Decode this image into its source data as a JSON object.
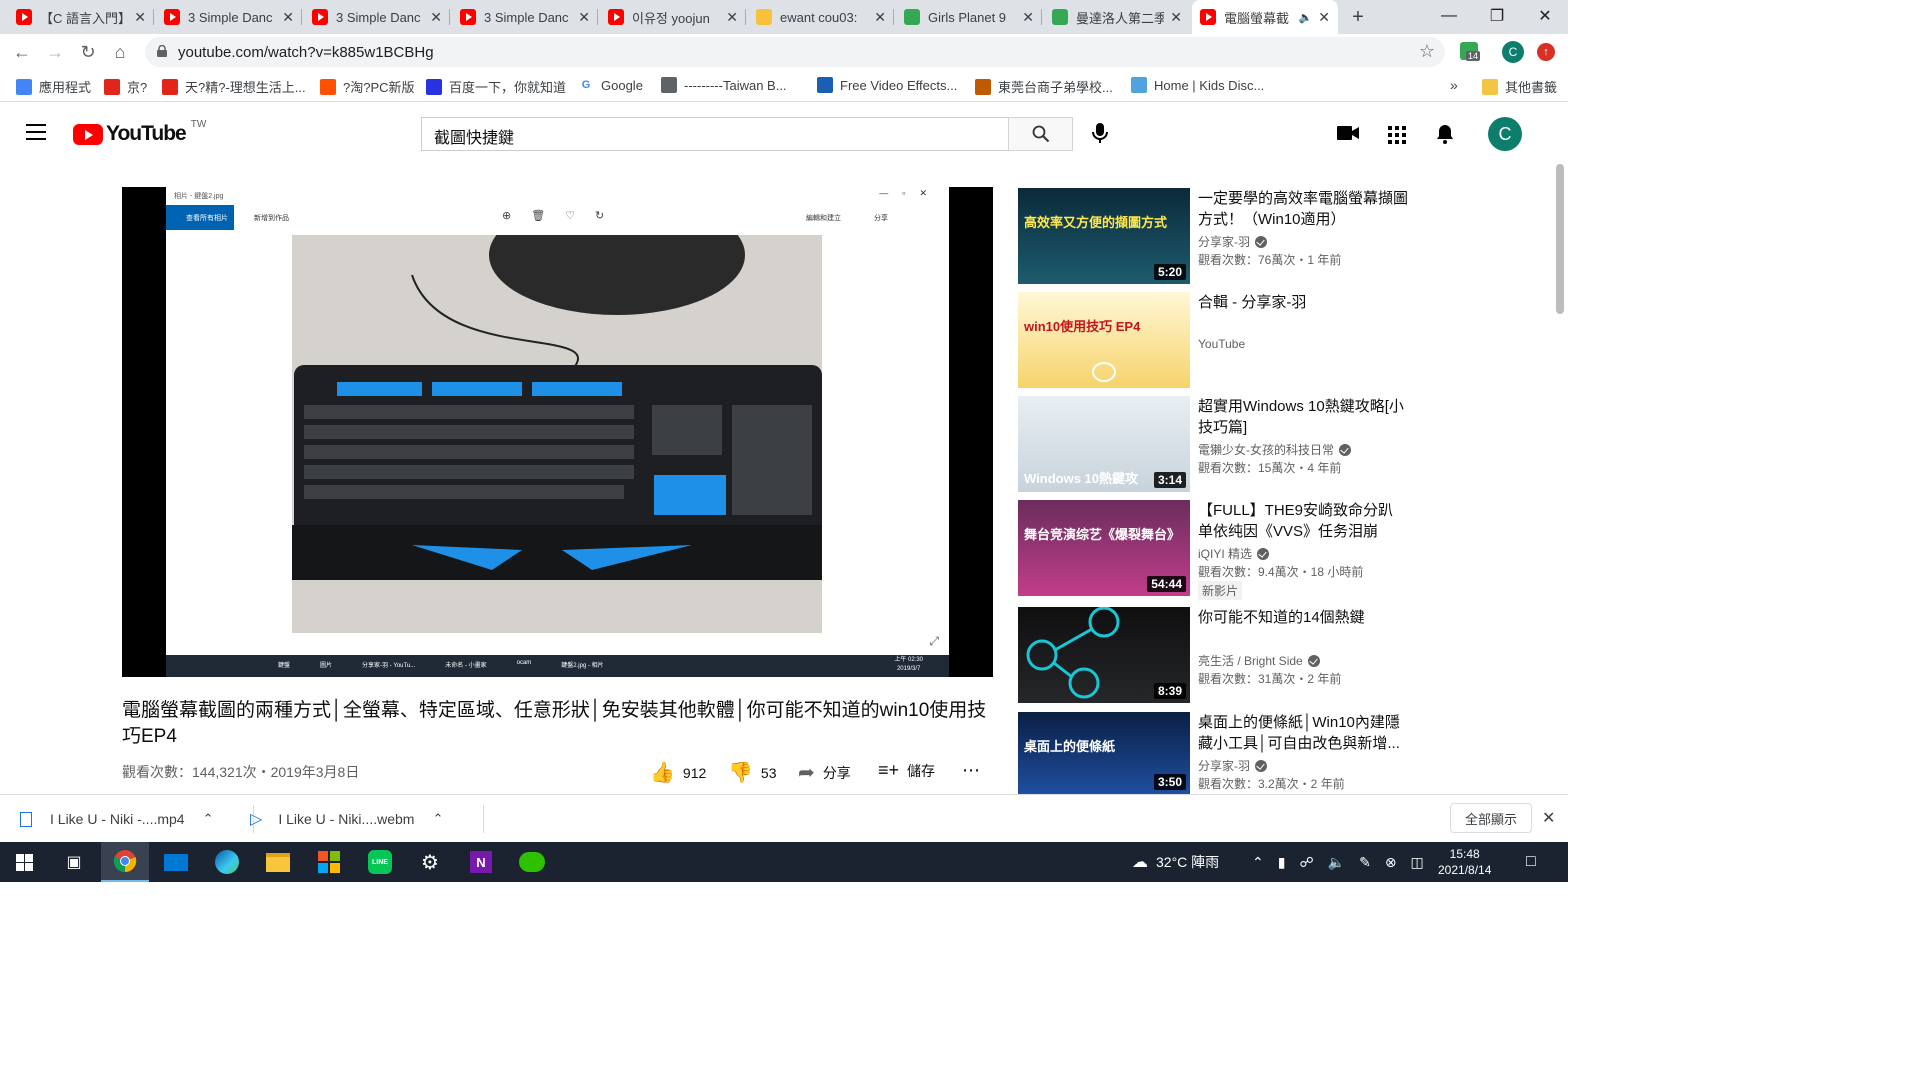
{
  "browser": {
    "tabs": [
      {
        "title": "【C 語言入門】",
        "favicon": "youtube-icon"
      },
      {
        "title": "3 Simple Danc",
        "favicon": "youtube-icon"
      },
      {
        "title": "3 Simple Danc",
        "favicon": "youtube-icon"
      },
      {
        "title": "3 Simple Danc",
        "favicon": "youtube-icon"
      },
      {
        "title": "이유정 yoojun",
        "favicon": "youtube-icon"
      },
      {
        "title": "ewant cou03:",
        "favicon": "ewant-icon"
      },
      {
        "title": "Girls Planet 9",
        "favicon": "site-icon"
      },
      {
        "title": "曼達洛人第二季",
        "favicon": "site-icon"
      },
      {
        "title": "電腦螢幕截",
        "favicon": "youtube-icon"
      }
    ],
    "new_tab": "+",
    "url": "youtube.com/watch?v=k885w1BCBHg",
    "profile_initial": "C",
    "extension_badge": "14",
    "bookmarks": [
      {
        "label": "應用程式",
        "icon": "apps-grid-icon"
      },
      {
        "label": "京?",
        "icon": "jd-icon"
      },
      {
        "label": "天?精?-理想生活上...",
        "icon": "tmall-icon"
      },
      {
        "label": "?淘?PC新版",
        "icon": "taobao-icon"
      },
      {
        "label": "百度一下，你就知道",
        "icon": "baidu-icon"
      },
      {
        "label": "Google",
        "icon": "google-icon"
      },
      {
        "label": "---------Taiwan B...",
        "icon": "globe-icon"
      },
      {
        "label": "Free Video Effects...",
        "icon": "dz-icon"
      },
      {
        "label": "東莞台商子弟學校...",
        "icon": "school-icon"
      },
      {
        "label": "Home | Kids Disc...",
        "icon": "kids-icon"
      }
    ],
    "bookmarks_more": "»",
    "other_bookmarks": "其他書籤"
  },
  "youtube": {
    "logo_text": "YouTube",
    "region": "TW",
    "search_value": "截圖快捷鍵",
    "avatar_initial": "C",
    "video": {
      "title": "電腦螢幕截圖的兩種方式│全螢幕、特定區域、任意形狀│免安裝其他軟體│你可能不知道的win10使用技巧EP4",
      "views_date": "觀看次數：144,321次・2019年3月8日",
      "likes": "912",
      "dislikes": "53",
      "share": "分享",
      "save": "儲存",
      "more": "⋯"
    },
    "recommendations": [
      {
        "title": "一定要學的高效率電腦螢幕擷圖方式！（Win10適用）",
        "channel": "分享家-羽",
        "verified": true,
        "views": "觀看次數：76萬次・1 年前",
        "duration": "5:20",
        "badge": "",
        "thumb_text": "高效率又方便的擷圖方式"
      },
      {
        "title": "合輯 - 分享家-羽",
        "channel": "YouTube",
        "verified": false,
        "views": "",
        "duration": "",
        "badge": "",
        "thumb_text": "win10使用技巧 EP4"
      },
      {
        "title": "超實用Windows 10熱鍵攻略[小技巧篇]",
        "channel": "電獺少女-女孩的科技日常",
        "verified": true,
        "views": "觀看次數：15萬次・4 年前",
        "duration": "3:14",
        "badge": "",
        "thumb_text": "Windows 10熱鍵攻"
      },
      {
        "title": "【FULL】THE9安崎致命分趴单依纯因《VVS》任务泪崩 硬...",
        "channel": "iQIYI 精选",
        "verified": true,
        "views": "觀看次數：9.4萬次・18 小時前",
        "duration": "54:44",
        "badge": "新影片",
        "thumb_text": "舞台竞演综艺《爆裂舞台》"
      },
      {
        "title": "你可能不知道的14個熱鍵",
        "channel": "亮生活 / Bright Side",
        "verified": true,
        "views": "觀看次數：31萬次・2 年前",
        "duration": "8:39",
        "badge": "",
        "thumb_text": ""
      },
      {
        "title": "桌面上的便條紙│Win10內建隱藏小工具│可自由改色與新增...",
        "channel": "分享家-羽",
        "verified": true,
        "views": "觀看次數：3.2萬次・2 年前",
        "duration": "3:50",
        "badge": "",
        "thumb_text": "桌面上的便條紙"
      }
    ]
  },
  "player_window": {
    "title": "相片 - 鍵盤2.jpg",
    "tab_all": "查看所有相片",
    "tab_new": "新增到作品",
    "edit": "編輯和建立",
    "share": "分享",
    "taskbar_items": [
      "鍵盤",
      "圖片",
      "分享家-羽 - YouTu...",
      "未命名 - 小畫家",
      "ocam",
      "鍵盤2.jpg - 相片"
    ],
    "clock": "上午 02:30",
    "date": "2019/3/7"
  },
  "downloads": {
    "items": [
      {
        "name": "I Like U - Niki -....mp4",
        "icon": "file-icon"
      },
      {
        "name": "I Like U - Niki....webm",
        "icon": "play-icon"
      }
    ],
    "show_all": "全部顯示"
  },
  "taskbar": {
    "weather": "32°C 陣雨",
    "time": "15:48",
    "date": "2021/8/14"
  }
}
